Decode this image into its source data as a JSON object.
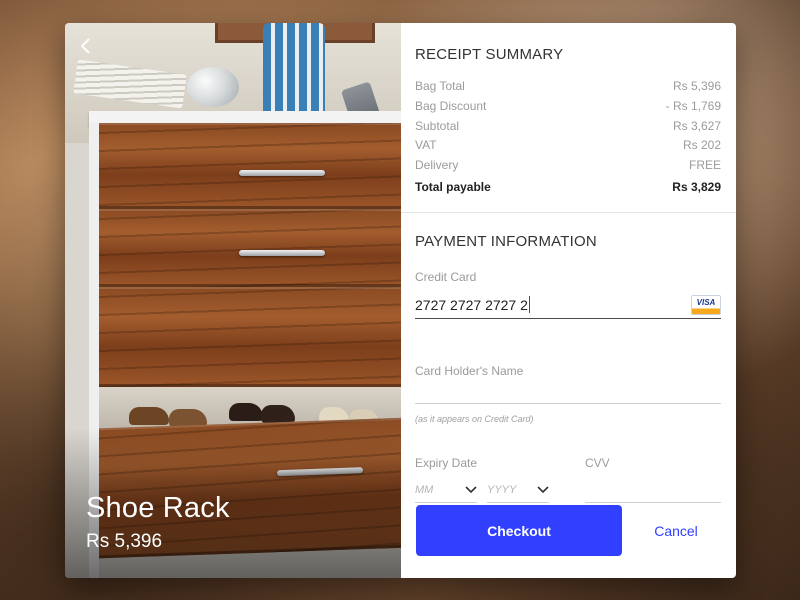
{
  "product": {
    "title": "Shoe Rack",
    "price": "Rs 5,396",
    "back_icon": "chevron-left-icon"
  },
  "receipt": {
    "title": "RECEIPT SUMMARY",
    "rows": [
      {
        "label": "Bag Total",
        "value": "Rs 5,396"
      },
      {
        "label": "Bag Discount",
        "value": "- Rs 1,769"
      },
      {
        "label": "Subtotal",
        "value": "Rs 3,627"
      },
      {
        "label": "VAT",
        "value": "Rs 202"
      },
      {
        "label": "Delivery",
        "value": "FREE"
      }
    ],
    "total": {
      "label": "Total payable",
      "value": "Rs 3,829"
    }
  },
  "payment": {
    "title": "PAYMENT INFORMATION",
    "credit_card": {
      "label": "Credit Card",
      "value": "2727 2727 2727 2",
      "card_brand": "VISA"
    },
    "card_holder": {
      "label": "Card Holder's Name",
      "value": "",
      "hint": "(as it appears on Credit Card)"
    },
    "expiry": {
      "label": "Expiry Date",
      "month_placeholder": "MM",
      "year_placeholder": "YYYY"
    },
    "cvv": {
      "label": "CVV",
      "value": ""
    }
  },
  "actions": {
    "checkout_label": "Checkout",
    "cancel_label": "Cancel"
  },
  "colors": {
    "accent": "#3140ff",
    "panel_bg": "#ffffff",
    "muted_text": "#9b9b9b"
  }
}
